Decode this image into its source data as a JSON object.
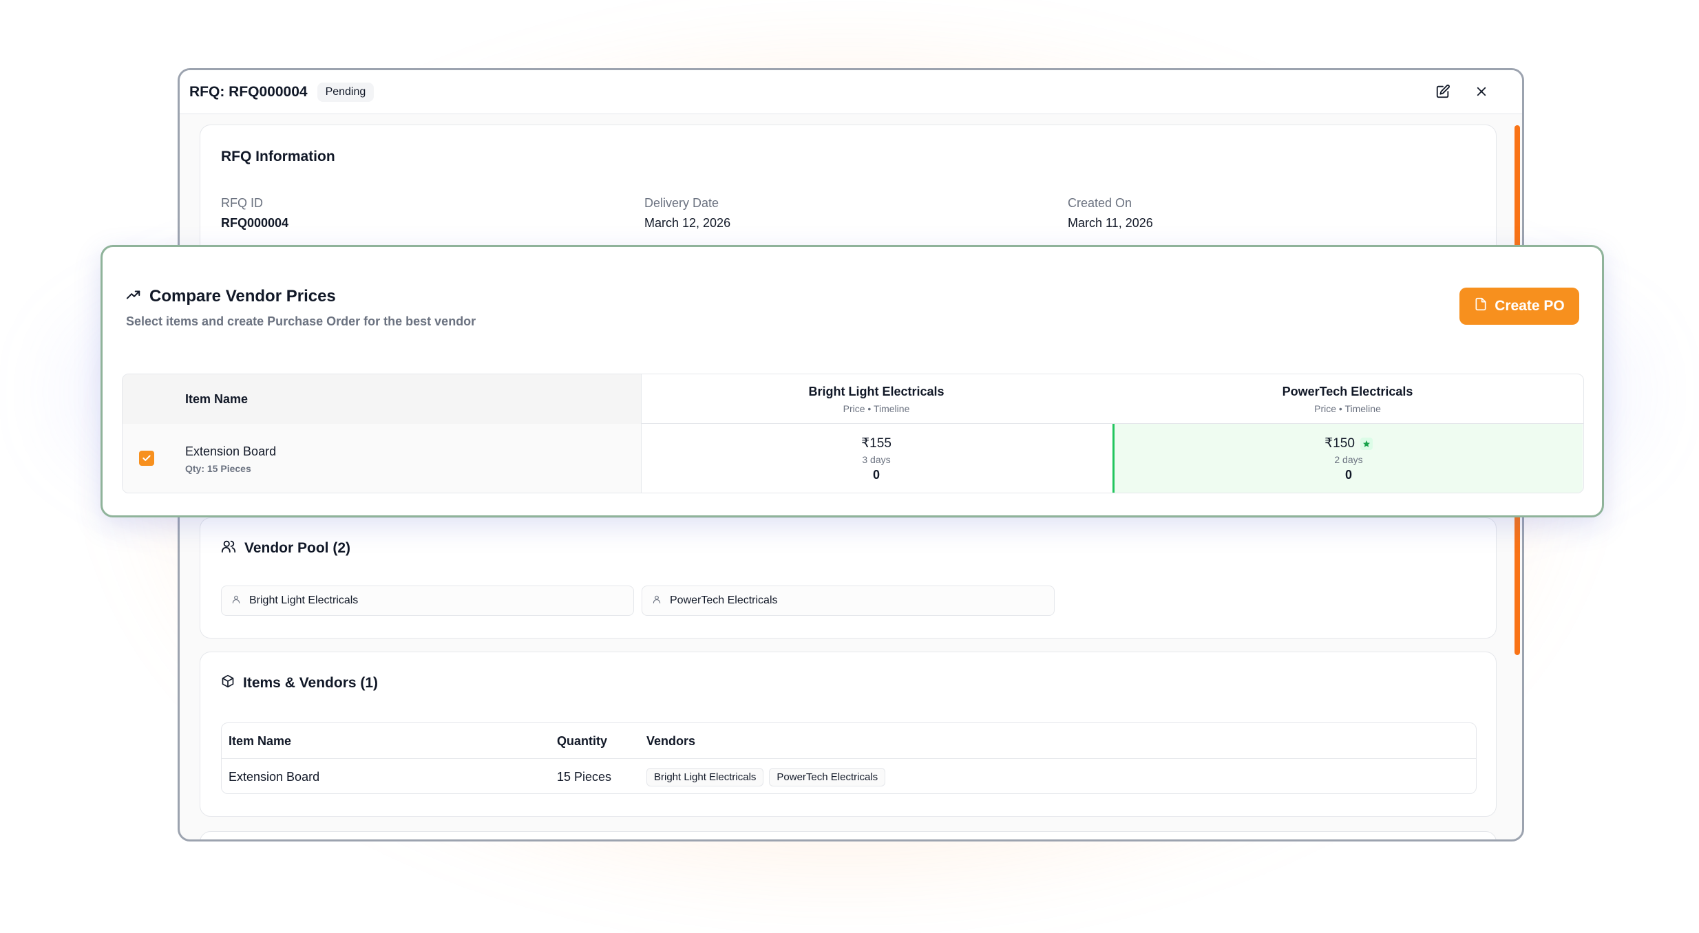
{
  "modal": {
    "title": "RFQ: RFQ000004",
    "status": "Pending",
    "icons": {
      "edit": "edit-icon",
      "close": "close-icon"
    }
  },
  "rfq_info": {
    "title": "RFQ Information",
    "fields": [
      {
        "label": "RFQ ID",
        "value": "RFQ000004"
      },
      {
        "label": "Delivery Date",
        "value": "March 12, 2026"
      },
      {
        "label": "Created On",
        "value": "March 11, 2026"
      }
    ]
  },
  "compare": {
    "title": "Compare Vendor Prices",
    "subtitle": "Select items and create Purchase Order for the best vendor",
    "create_po_label": "Create PO",
    "item_column": "Item Name",
    "vendors": [
      {
        "name": "Bright Light Electricals",
        "sub": "Price • Timeline"
      },
      {
        "name": "PowerTech Electricals",
        "sub": "Price • Timeline"
      }
    ],
    "rows": [
      {
        "selected": true,
        "item": "Extension Board",
        "qty": "Qty: 15 Pieces",
        "quotes": [
          {
            "price": "₹155",
            "days": "3 days",
            "extra": "0",
            "best": false
          },
          {
            "price": "₹150",
            "days": "2 days",
            "extra": "0",
            "best": true
          }
        ]
      }
    ],
    "colors": {
      "accent": "#f7901e",
      "best_bg": "#effcf1",
      "best_border": "#22c55e"
    }
  },
  "vendor_pool": {
    "title": "Vendor Pool (2)",
    "vendors": [
      "Bright Light Electricals",
      "PowerTech Electricals"
    ]
  },
  "items_vendors": {
    "title": "Items & Vendors (1)",
    "columns": [
      "Item Name",
      "Quantity",
      "Vendors"
    ],
    "rows": [
      {
        "item": "Extension Board",
        "quantity": "15 Pieces",
        "vendors": [
          "Bright Light Electricals",
          "PowerTech Electricals"
        ]
      }
    ]
  }
}
